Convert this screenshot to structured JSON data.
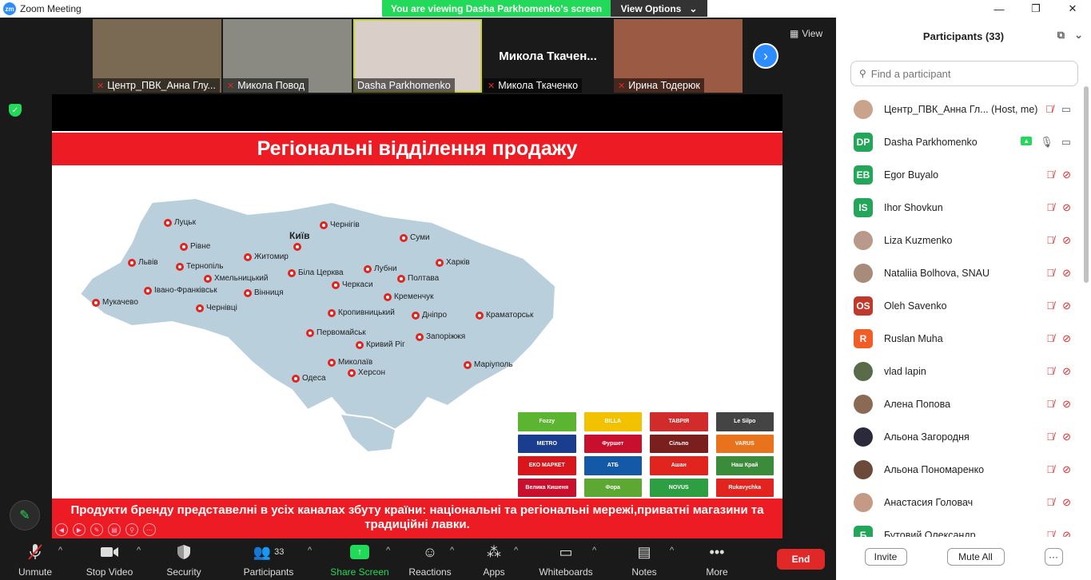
{
  "window": {
    "title": "Zoom Meeting",
    "controls": [
      "—",
      "❐",
      "✕"
    ]
  },
  "share_banner": {
    "viewing": "You are viewing Dasha Parkhomenko's screen",
    "options": "View Options"
  },
  "view_button": "View",
  "thumbnails": [
    {
      "name": "Центр_ПВК_Анна Глу...",
      "muted": true,
      "bg": "#7a6a54"
    },
    {
      "name": "Микола Повод",
      "muted": true,
      "bg": "#8a8a82"
    },
    {
      "name": "Dasha Parkhomenko",
      "muted": false,
      "bg": "#d9cfc8",
      "active": true
    },
    {
      "name": "Микола Ткаченко",
      "muted": true,
      "bg": "#1a1a1a",
      "big_name": "Микола  Ткачен..."
    },
    {
      "name": "Ирина Тодерюк",
      "muted": true,
      "bg": "#9b5a43"
    }
  ],
  "slide": {
    "title": "Регіональні відділення продажу",
    "footer": "Продукти бренду представелні в усіх каналах збуту країни: національні та регіональні мережі,приватні магазини та традиційні лавки.",
    "capital": "Київ",
    "cities": [
      "Луцьк",
      "Рівне",
      "Львів",
      "Тернопіль",
      "Хмельницький",
      "Івано-Франківськ",
      "Мукачево",
      "Чернівці",
      "Житомир",
      "Біла Церква",
      "Вінниця",
      "Чернігів",
      "Суми",
      "Лубни",
      "Харків",
      "Полтава",
      "Черкаси",
      "Кременчук",
      "Кропивницький",
      "Дніпро",
      "Краматорськ",
      "Первомайськ",
      "Кривий Ріг",
      "Запоріжжя",
      "Миколаїв",
      "Херсон",
      "Одеса",
      "Маріуполь"
    ],
    "retailers": [
      {
        "label": "Fozzy",
        "color": "#5cb531"
      },
      {
        "label": "BILLA",
        "color": "#f2c200"
      },
      {
        "label": "ТАВРІЯ",
        "color": "#d22b2b"
      },
      {
        "label": "Le Silpo",
        "color": "#444444"
      },
      {
        "label": "METRO",
        "color": "#1a3d8f"
      },
      {
        "label": "Фуршет",
        "color": "#c8102e"
      },
      {
        "label": "Сільпо",
        "color": "#7a1e1e"
      },
      {
        "label": "VARUS",
        "color": "#e8731c"
      },
      {
        "label": "ЕКО МАРКЕТ",
        "color": "#d8161c"
      },
      {
        "label": "АТБ",
        "color": "#1458a8"
      },
      {
        "label": "Ашан",
        "color": "#e2241e"
      },
      {
        "label": "Наш Край",
        "color": "#3a8b3a"
      },
      {
        "label": "Велика Кишеня",
        "color": "#c8102e"
      },
      {
        "label": "Фора",
        "color": "#5ca832"
      },
      {
        "label": "NOVUS",
        "color": "#2e9e43"
      },
      {
        "label": "Rukavychka",
        "color": "#e2241e"
      }
    ]
  },
  "toolbar": {
    "unmute": "Unmute",
    "stop_video": "Stop Video",
    "security": "Security",
    "participants": "Participants",
    "participants_count": "33",
    "share_screen": "Share Screen",
    "reactions": "Reactions",
    "apps": "Apps",
    "whiteboards": "Whiteboards",
    "notes": "Notes",
    "more": "More",
    "end": "End"
  },
  "panel": {
    "title": "Participants (33)",
    "search_placeholder": "Find a participant",
    "invite": "Invite",
    "mute_all": "Mute All",
    "more": "···",
    "participants": [
      {
        "name": "Центр_ПВК_Анна Гл...",
        "tag": "(Host, me)",
        "avatar": "",
        "color": "#c9a38b",
        "photo": true,
        "mic": "muted",
        "video": "on"
      },
      {
        "name": "Dasha Parkhomenko",
        "tag": "",
        "avatar": "DP",
        "color": "#23a55a",
        "photo": false,
        "mic": "on",
        "video": "on",
        "sharing": true
      },
      {
        "name": "Egor Buyalo",
        "tag": "",
        "avatar": "EB",
        "color": "#23a55a",
        "photo": false,
        "mic": "muted",
        "video": "off"
      },
      {
        "name": "Ihor Shovkun",
        "tag": "",
        "avatar": "IS",
        "color": "#23a55a",
        "photo": false,
        "mic": "muted",
        "video": "off"
      },
      {
        "name": "Liza Kuzmenko",
        "tag": "",
        "avatar": "",
        "color": "#b99a8a",
        "photo": true,
        "mic": "muted",
        "video": "off"
      },
      {
        "name": "Nataliia Bolhova, SNAU",
        "tag": "",
        "avatar": "",
        "color": "#a88b7a",
        "photo": true,
        "mic": "muted",
        "video": "off"
      },
      {
        "name": "Oleh Savenko",
        "tag": "",
        "avatar": "OS",
        "color": "#c0392b",
        "photo": false,
        "mic": "muted",
        "video": "off"
      },
      {
        "name": "Ruslan Muha",
        "tag": "",
        "avatar": "R",
        "color": "#f25c27",
        "photo": false,
        "mic": "muted",
        "video": "off"
      },
      {
        "name": "vlad lapin",
        "tag": "",
        "avatar": "",
        "color": "#5a6b4a",
        "photo": true,
        "mic": "muted",
        "video": "off"
      },
      {
        "name": "Алена Попова",
        "tag": "",
        "avatar": "",
        "color": "#8b6a55",
        "photo": true,
        "mic": "muted",
        "video": "off"
      },
      {
        "name": "Альона Загородня",
        "tag": "",
        "avatar": "",
        "color": "#2a2a3a",
        "photo": true,
        "mic": "muted",
        "video": "off"
      },
      {
        "name": "Альона Пономаренко",
        "tag": "",
        "avatar": "",
        "color": "#6b4a3a",
        "photo": true,
        "mic": "muted",
        "video": "off"
      },
      {
        "name": "Анастасия Головач",
        "tag": "",
        "avatar": "",
        "color": "#c49a84",
        "photo": true,
        "mic": "muted",
        "video": "off"
      },
      {
        "name": "Бутовий Олександр",
        "tag": "",
        "avatar": "Б",
        "color": "#23a55a",
        "photo": false,
        "mic": "muted",
        "video": "off"
      }
    ]
  }
}
